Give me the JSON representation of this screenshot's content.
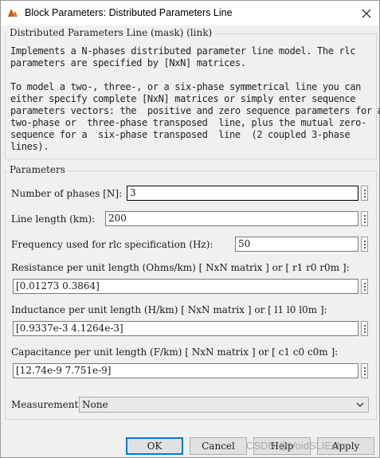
{
  "window": {
    "title": "Block Parameters: Distributed Parameters Line"
  },
  "mask": {
    "legend": "Distributed Parameters Line (mask) (link)",
    "description": [
      "Implements a N-phases distributed parameter line model. The rlc",
      "parameters are specified by [NxN] matrices.",
      "",
      "To model a two-, three-, or a six-phase symmetrical line you can",
      "either specify complete [NxN] matrices or simply enter sequence",
      "parameters vectors: the  positive and zero sequence parameters for a",
      "two-phase or  three-phase transposed  line, plus the mutual zero-",
      "sequence for a  six-phase transposed  line  (2 coupled 3-phase",
      "lines)."
    ]
  },
  "parameters": {
    "legend": "Parameters",
    "phases": {
      "label": "Number of phases [N]:",
      "value": "3"
    },
    "length": {
      "label": "Line length (km):",
      "value": "200"
    },
    "frequency": {
      "label": "Frequency used for rlc specification (Hz):",
      "value": "50"
    },
    "resistance": {
      "label": "Resistance per unit length (Ohms/km) [ NxN matrix ] or [ r1 r0 r0m ]:",
      "value": "[0.01273 0.3864]"
    },
    "inductance": {
      "label": "Inductance per unit length (H/km) [ NxN matrix ] or [ l1 l0 l0m ]:",
      "value": "[0.9337e-3  4.1264e-3]"
    },
    "capacitance": {
      "label": "Capacitance per unit length (F/km) [ NxN matrix ] or [ c1 c0 c0m ]:",
      "value": "[12.74e-9 7.751e-9]"
    },
    "measurements": {
      "label": "Measurements",
      "selected": "None"
    }
  },
  "buttons": {
    "ok": "OK",
    "cancel": "Cancel",
    "help": "Help",
    "apply": "Apply"
  },
  "watermark": "CSDN @VoidSLIEcho",
  "icons": {
    "app": "simulink-block-icon",
    "close": "close-icon",
    "dropdown": "chevron-down-icon",
    "more": "dots-menu-icon"
  },
  "colors": {
    "focus_border": "#0078d7",
    "window_bg": "#f0f0f0",
    "app_icon": "#e3772b"
  }
}
